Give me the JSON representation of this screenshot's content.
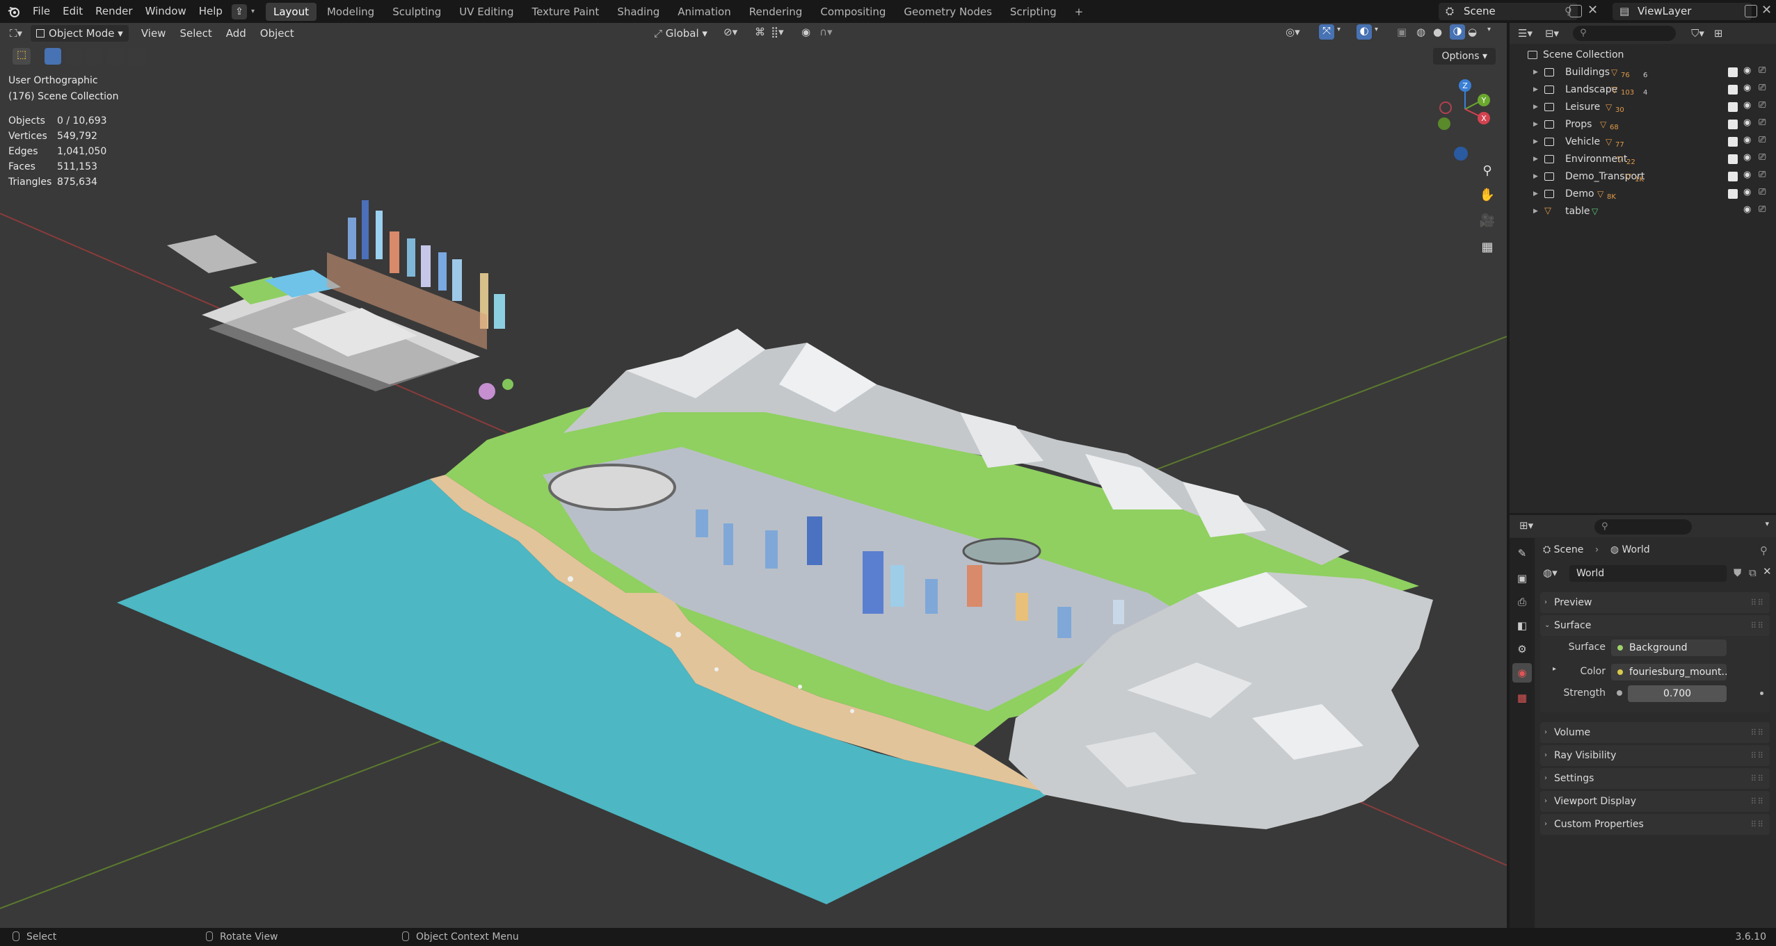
{
  "topbar": {
    "menus": [
      "File",
      "Edit",
      "Render",
      "Window",
      "Help"
    ],
    "workspaces": [
      "Layout",
      "Modeling",
      "Sculpting",
      "UV Editing",
      "Texture Paint",
      "Shading",
      "Animation",
      "Rendering",
      "Compositing",
      "Geometry Nodes",
      "Scripting"
    ],
    "active_workspace": "Layout",
    "add_workspace": "+",
    "scene": "Scene",
    "view_layer": "ViewLayer"
  },
  "viewport": {
    "mode": "Object Mode",
    "menus": [
      "View",
      "Select",
      "Add",
      "Object"
    ],
    "orientation": "Global",
    "options_label": "Options",
    "view_name": "User Orthographic",
    "collection_info": "(176) Scene Collection",
    "stats": [
      {
        "label": "Objects",
        "value": "0 / 10,693"
      },
      {
        "label": "Vertices",
        "value": "549,792"
      },
      {
        "label": "Edges",
        "value": "1,041,050"
      },
      {
        "label": "Faces",
        "value": "511,153"
      },
      {
        "label": "Triangles",
        "value": "875,634"
      }
    ],
    "gizmo": {
      "z": "Z",
      "y": "Y",
      "x": "X"
    },
    "colors": {
      "water": "#4db7c3",
      "sand": "#e2c49a",
      "grass": "#8fd060",
      "mountain": "#cfd2d4"
    }
  },
  "outliner": {
    "root": "Scene Collection",
    "items": [
      {
        "label": "Buildings",
        "count1": "76",
        "count2": "6"
      },
      {
        "label": "Landscape",
        "count1": "103",
        "count2": "4"
      },
      {
        "label": "Leisure",
        "count1": "30",
        "count2": ""
      },
      {
        "label": "Props",
        "count1": "68",
        "count2": ""
      },
      {
        "label": "Vehicle",
        "count1": "77",
        "count2": ""
      },
      {
        "label": "Environment",
        "count1": "22",
        "count2": ""
      },
      {
        "label": "Demo_Transport",
        "count1": "1K",
        "count2": ""
      },
      {
        "label": "Demo",
        "count1": "8K",
        "count2": ""
      },
      {
        "label": "table",
        "count1": "",
        "count2": ""
      }
    ]
  },
  "properties": {
    "breadcrumb_scene": "Scene",
    "breadcrumb_world": "World",
    "world_name": "World",
    "panels": {
      "preview": "Preview",
      "surface": "Surface",
      "volume": "Volume",
      "ray_visibility": "Ray Visibility",
      "settings": "Settings",
      "viewport_display": "Viewport Display",
      "custom_properties": "Custom Properties"
    },
    "surface_label": "Surface",
    "surface_value": "Background",
    "color_label": "Color",
    "color_value": "fouriesburg_mount...",
    "strength_label": "Strength",
    "strength_value": "0.700"
  },
  "statusbar": {
    "select": "Select",
    "rotate": "Rotate View",
    "context": "Object Context Menu",
    "version": "3.6.10"
  }
}
